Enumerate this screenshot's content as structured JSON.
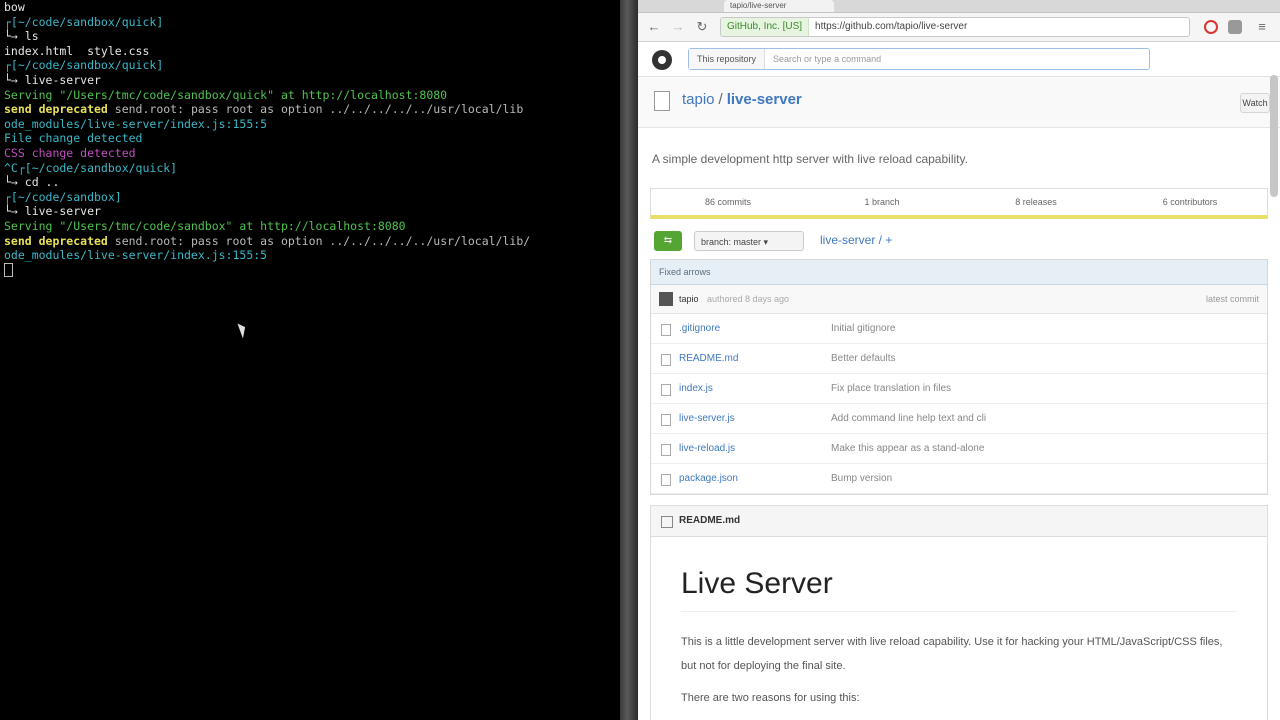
{
  "terminal": {
    "lines": [
      {
        "text": "bow",
        "cls": "c-white"
      },
      {
        "text": "┌[~/code/sandbox/quick]",
        "cls": "c-cyan"
      },
      {
        "text": "└→ ls",
        "cls": "c-white"
      },
      {
        "text": "index.html  style.css",
        "cls": "c-white"
      },
      {
        "text": "┌[~/code/sandbox/quick]",
        "cls": "c-cyan"
      },
      {
        "text": "└→ live-server",
        "cls": "c-white"
      },
      {
        "text": "Serving \"/Users/tmc/code/sandbox/quick\" at http://localhost:8080",
        "cls": "c-green"
      },
      {
        "text": "send deprecated send.root: pass root as option ../../../../../usr/local/lib",
        "cls": "c-mixed"
      },
      {
        "text": "ode_modules/live-server/index.js:155:5",
        "cls": "c-cyan"
      },
      {
        "text": "File change detected",
        "cls": "c-cyan"
      },
      {
        "text": "CSS change detected",
        "cls": "c-magenta"
      },
      {
        "text": "^C┌[~/code/sandbox/quick]",
        "cls": "c-cyan"
      },
      {
        "text": "└→ cd ..",
        "cls": "c-white"
      },
      {
        "text": "┌[~/code/sandbox]",
        "cls": "c-cyan"
      },
      {
        "text": "└→ live-server",
        "cls": "c-white"
      },
      {
        "text": "Serving \"/Users/tmc/code/sandbox\" at http://localhost:8080",
        "cls": "c-green"
      },
      {
        "text": "send deprecated send.root: pass root as option ../../../../../usr/local/lib/",
        "cls": "c-mixed"
      },
      {
        "text": "ode_modules/live-server/index.js:155:5",
        "cls": "c-cyan"
      }
    ]
  },
  "browser": {
    "tab_title": "tapio/live-server",
    "secure_label": "GitHub, Inc. [US]",
    "url": "https://github.com/tapio/live-server",
    "github": {
      "search_scope": "This repository",
      "search_placeholder": "Search or type a command",
      "repo_owner": "tapio",
      "repo_name": "live-server",
      "watch_label": "Watch",
      "description": "A simple development http server with live reload capability.",
      "stats": [
        "86 commits",
        "1 branch",
        "8 releases",
        "6 contributors"
      ],
      "compare_label": "⇆",
      "branch_label": "branch: master ▾",
      "breadcrumb": "live-server / +",
      "commit_bar": "Fixed arrows",
      "last_commit": {
        "author": "tapio",
        "message": "authored 8 days ago",
        "right": "latest commit"
      },
      "files": [
        {
          "name": ".gitignore",
          "msg": "Initial gitignore"
        },
        {
          "name": "README.md",
          "msg": "Better defaults"
        },
        {
          "name": "index.js",
          "msg": "Fix place translation in files"
        },
        {
          "name": "live-server.js",
          "msg": "Add command line help text and cli"
        },
        {
          "name": "live-reload.js",
          "msg": "Make this appear as a stand-alone"
        },
        {
          "name": "package.json",
          "msg": "Bump version"
        }
      ],
      "readme_label": "README.md",
      "readme_title": "Live Server",
      "readme_p1": "This is a little development server with live reload capability. Use it for hacking your HTML/JavaScript/CSS files,",
      "readme_p1b": "but not for deploying the final site.",
      "readme_p2": "There are two reasons for using this:"
    }
  },
  "colors": {
    "terminal_bg": "#000000",
    "prompt_cyan": "#3ab8c8",
    "serving_green": "#4fc24f",
    "css_magenta": "#c04fc0",
    "deprecated_yellow": "#e8e05a",
    "github_link": "#4078c0",
    "compare_green": "#55a532"
  }
}
